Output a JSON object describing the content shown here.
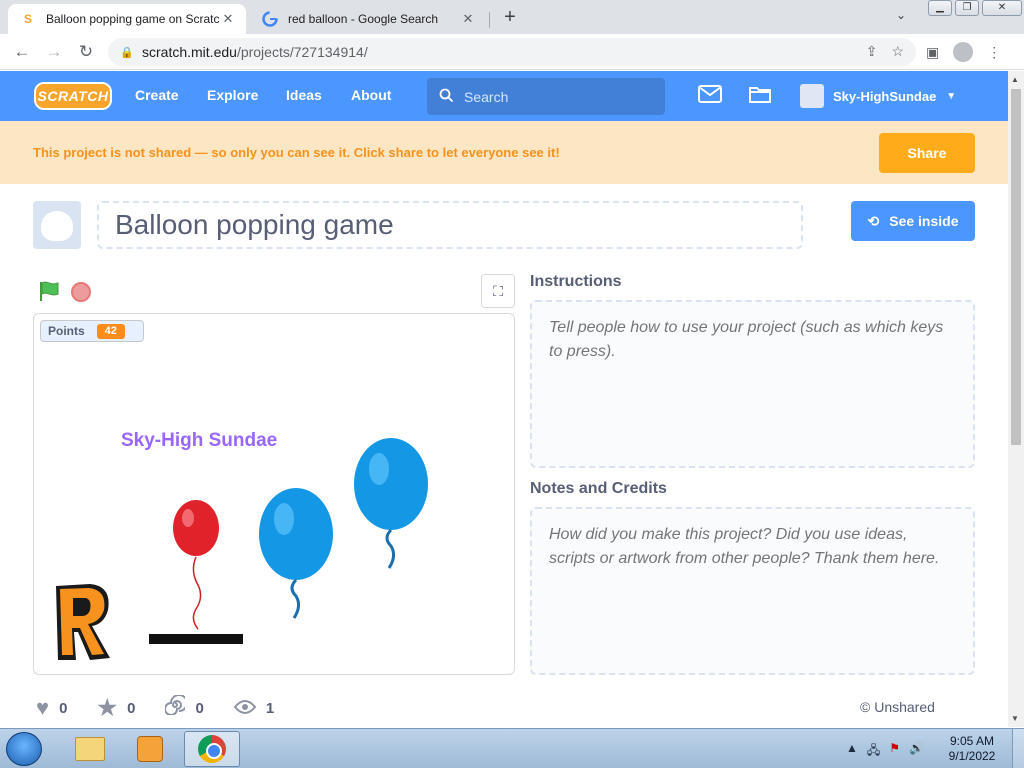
{
  "browser": {
    "tabs": [
      {
        "title": "Balloon popping game on Scratch",
        "icon": "scratch-favicon",
        "active": true
      },
      {
        "title": "red balloon - Google Search",
        "icon": "google-favicon",
        "active": false
      }
    ],
    "url_host": "scratch.mit.edu",
    "url_path": "/projects/727134914/"
  },
  "nav": {
    "logo": "SCRATCH",
    "links": [
      "Create",
      "Explore",
      "Ideas",
      "About"
    ],
    "search_placeholder": "Search",
    "username": "Sky-HighSundae"
  },
  "banner": {
    "message": "This project is not shared — so only you can see it. Click share to let everyone see it!",
    "share_label": "Share"
  },
  "project": {
    "title": "Balloon popping game",
    "see_inside_label": "See inside",
    "monitor_label": "Points",
    "monitor_value": "42",
    "stage_text": "Sky-High Sundae",
    "instructions_label": "Instructions",
    "instructions_placeholder": "Tell people how to use your project (such as which keys to press).",
    "notes_label": "Notes and Credits",
    "notes_placeholder": "How did you make this project? Did you use ideas, scripts or artwork from other people? Thank them here.",
    "stats": {
      "loves": "0",
      "favorites": "0",
      "remixes": "0",
      "views": "1"
    },
    "status": "© Unshared"
  },
  "taskbar": {
    "time": "9:05 AM",
    "date": "9/1/2022"
  },
  "colors": {
    "scratch_blue": "#4c97ff",
    "banner_bg": "#fde6c4",
    "share_orange": "#ffab1a"
  }
}
